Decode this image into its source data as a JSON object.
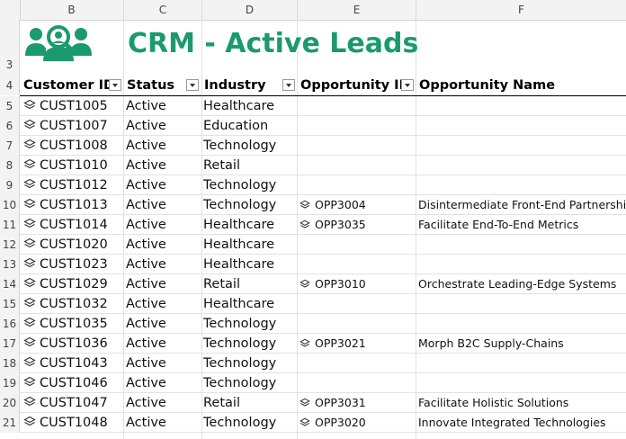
{
  "columns": [
    "B",
    "C",
    "D",
    "E",
    "F"
  ],
  "title": "CRM - Active Leads",
  "logo_icon": "customer-search-icon",
  "brand_color": "#1a9a6e",
  "table": {
    "headers": [
      "Customer ID",
      "Status",
      "Industry",
      "Opportunity ID",
      "Opportunity Name"
    ],
    "rows": [
      {
        "row": "5",
        "customer_id": "CUST1005",
        "status": "Active",
        "industry": "Healthcare",
        "opp_id": "",
        "opp_name": ""
      },
      {
        "row": "6",
        "customer_id": "CUST1007",
        "status": "Active",
        "industry": "Education",
        "opp_id": "",
        "opp_name": ""
      },
      {
        "row": "7",
        "customer_id": "CUST1008",
        "status": "Active",
        "industry": "Technology",
        "opp_id": "",
        "opp_name": ""
      },
      {
        "row": "8",
        "customer_id": "CUST1010",
        "status": "Active",
        "industry": "Retail",
        "opp_id": "",
        "opp_name": ""
      },
      {
        "row": "9",
        "customer_id": "CUST1012",
        "status": "Active",
        "industry": "Technology",
        "opp_id": "",
        "opp_name": ""
      },
      {
        "row": "10",
        "customer_id": "CUST1013",
        "status": "Active",
        "industry": "Technology",
        "opp_id": "OPP3004",
        "opp_name": "Disintermediate Front-End Partnershi"
      },
      {
        "row": "11",
        "customer_id": "CUST1014",
        "status": "Active",
        "industry": "Healthcare",
        "opp_id": "OPP3035",
        "opp_name": "Facilitate End-To-End Metrics"
      },
      {
        "row": "12",
        "customer_id": "CUST1020",
        "status": "Active",
        "industry": "Healthcare",
        "opp_id": "",
        "opp_name": ""
      },
      {
        "row": "13",
        "customer_id": "CUST1023",
        "status": "Active",
        "industry": "Healthcare",
        "opp_id": "",
        "opp_name": ""
      },
      {
        "row": "14",
        "customer_id": "CUST1029",
        "status": "Active",
        "industry": "Retail",
        "opp_id": "OPP3010",
        "opp_name": "Orchestrate Leading-Edge Systems"
      },
      {
        "row": "15",
        "customer_id": "CUST1032",
        "status": "Active",
        "industry": "Healthcare",
        "opp_id": "",
        "opp_name": ""
      },
      {
        "row": "16",
        "customer_id": "CUST1035",
        "status": "Active",
        "industry": "Technology",
        "opp_id": "",
        "opp_name": ""
      },
      {
        "row": "17",
        "customer_id": "CUST1036",
        "status": "Active",
        "industry": "Technology",
        "opp_id": "OPP3021",
        "opp_name": "Morph B2C Supply-Chains"
      },
      {
        "row": "18",
        "customer_id": "CUST1043",
        "status": "Active",
        "industry": "Technology",
        "opp_id": "",
        "opp_name": ""
      },
      {
        "row": "19",
        "customer_id": "CUST1046",
        "status": "Active",
        "industry": "Technology",
        "opp_id": "",
        "opp_name": ""
      },
      {
        "row": "20",
        "customer_id": "CUST1047",
        "status": "Active",
        "industry": "Retail",
        "opp_id": "OPP3031",
        "opp_name": "Facilitate Holistic Solutions"
      },
      {
        "row": "21",
        "customer_id": "CUST1048",
        "status": "Active",
        "industry": "Technology",
        "opp_id": "OPP3020",
        "opp_name": "Innovate Integrated Technologies"
      }
    ]
  },
  "header_rows": [
    "3",
    "4"
  ]
}
